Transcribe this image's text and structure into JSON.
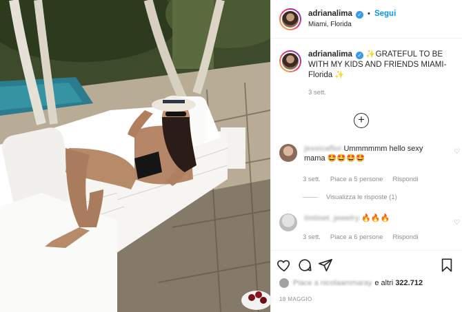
{
  "header": {
    "username": "adrianalima",
    "follow_label": "Segui",
    "separator": "•",
    "location": "Miami, Florida"
  },
  "caption": {
    "username": "adrianalima",
    "text": "GRATEFUL TO BE WITH MY KIDS AND FRIENDS MIAMI-Florida",
    "time": "3 sett."
  },
  "comments": [
    {
      "username": "jessicaflor",
      "text": "Ummmmmm hello sexy mama",
      "emoji": "🤩🤩🤩🤩",
      "time": "3 sett.",
      "likes": "Piace a 5 persone",
      "reply": "Rispondi",
      "view_replies": "Visualizza le risposte (1)"
    },
    {
      "username": "tintinet_jewelry",
      "text": "",
      "emoji": "🔥🔥🔥",
      "time": "3 sett.",
      "likes": "Piace a 6 persone",
      "reply": "Rispondi"
    }
  ],
  "likes": {
    "blurred_name": "Piace a nicolaammaray",
    "suffix": "e altri",
    "count": "322.712"
  },
  "date": "18 MAGGIO",
  "icons": {
    "like": "heart-icon",
    "comment": "comment-icon",
    "share": "share-icon",
    "save": "bookmark-icon",
    "more": "plus-circle-icon"
  }
}
